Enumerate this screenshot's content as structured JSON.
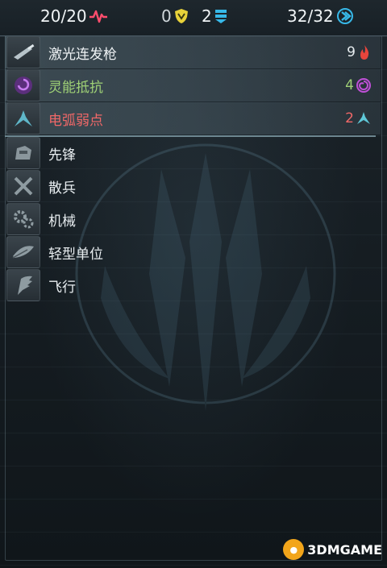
{
  "top_bar": {
    "health": "20/20",
    "health_icon": "heartbeat-icon",
    "shield": "0",
    "shield_icon": "shield-icon",
    "armor": "2",
    "armor_icon": "armor-stack-icon",
    "energy": "32/32",
    "energy_icon": "speed-arrow-icon"
  },
  "traits": [
    {
      "label": "激光连发枪",
      "value": "9",
      "icon": "laser-gun-icon",
      "value_icon": "flame-icon",
      "color": "#eef2f4"
    },
    {
      "label": "灵能抵抗",
      "value": "4",
      "icon": "psi-orb-icon",
      "value_icon": "psi-swirl-icon",
      "color": "#9fd176"
    },
    {
      "label": "电弧弱点",
      "value": "2",
      "icon": "arc-tripod-icon",
      "value_icon": "arc-tripod-icon",
      "color": "#f06868"
    }
  ],
  "tags": [
    {
      "label": "先锋",
      "icon": "vanguard-helmet-icon"
    },
    {
      "label": "散兵",
      "icon": "crossed-blades-icon"
    },
    {
      "label": "机械",
      "icon": "gears-icon"
    },
    {
      "label": "轻型单位",
      "icon": "feather-icon"
    },
    {
      "label": "飞行",
      "icon": "wing-icon"
    }
  ],
  "watermark": {
    "text": "3DMGAME"
  },
  "colors": {
    "accent": "#37b8e8",
    "health": "#ff4d6d",
    "shield": "#e8d23a",
    "arc": "#f06868",
    "psi": "#9fd176"
  }
}
